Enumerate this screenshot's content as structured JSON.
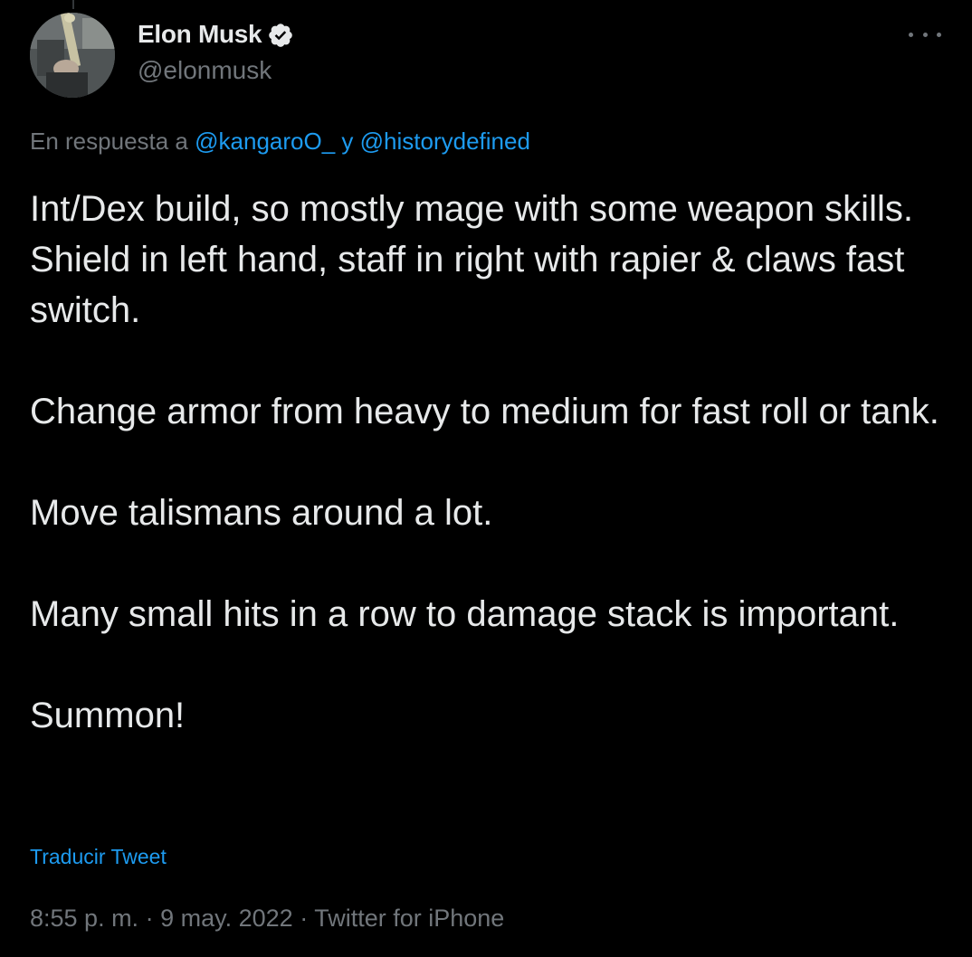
{
  "author": {
    "display_name": "Elon Musk",
    "handle": "@elonmusk",
    "verified": true,
    "avatar_icon": "profile-photo"
  },
  "reply": {
    "prefix": "En respuesta a",
    "mention_1": "@kangaroO_",
    "joiner": "y",
    "mention_2": "@historydefined"
  },
  "body": {
    "paragraphs": [
      "Int/Dex build, so mostly mage with some weapon skills. Shield in left hand, staff in right with rapier & claws fast switch.",
      "Change armor from heavy to medium for fast roll or tank.",
      "Move talismans around a lot.",
      "Many small hits in a row to damage stack is important.",
      "Summon!"
    ]
  },
  "translate_label": "Traducir Tweet",
  "meta": {
    "time": "8:55 p. m.",
    "date": "9 may. 2022",
    "source": "Twitter for iPhone",
    "separator": "·"
  },
  "colors": {
    "background": "#000000",
    "primary_text": "#e7e9ea",
    "secondary_text": "#71767b",
    "link": "#1d9bf0"
  },
  "icons": {
    "verified": "verified-badge-icon",
    "more": "more-options-icon"
  }
}
